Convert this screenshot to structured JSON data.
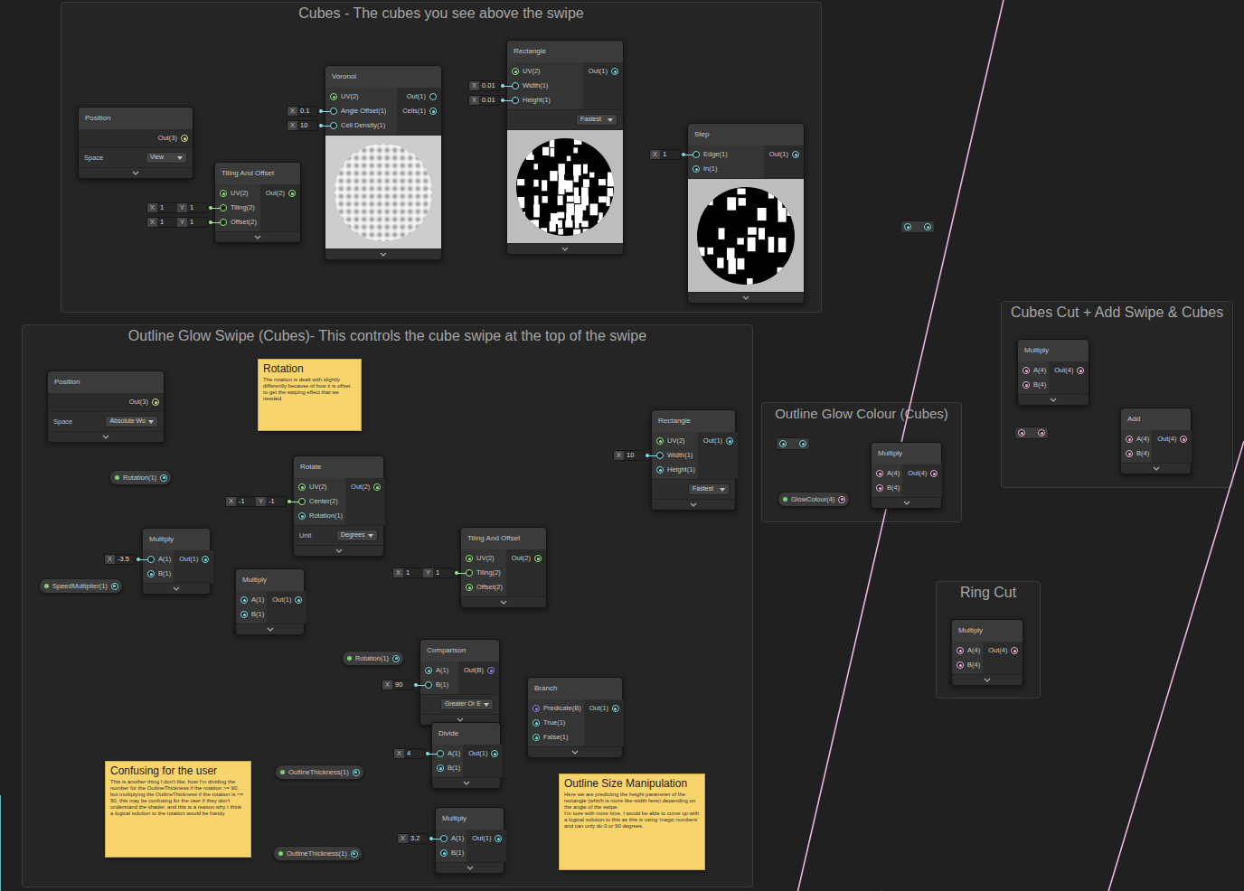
{
  "groups": [
    {
      "title": "Cubes - The cubes you see above the swipe"
    },
    {
      "title": "Outline Glow Swipe (Cubes)- This controls the cube swipe at the top of the swipe"
    },
    {
      "title": "Outline Glow Colour (Cubes)"
    },
    {
      "title": "Cubes Cut + Add Swipe & Cubes"
    },
    {
      "title": "Ring Cut"
    }
  ],
  "nodes": [
    {
      "title": "Position",
      "inputs": [],
      "outputs": [
        {
          "label": "Out(3)",
          "connected": true
        }
      ],
      "controls": [
        {
          "label": "Space",
          "value": "View"
        }
      ]
    },
    {
      "title": "Tiling And Offset",
      "inputs": [
        {
          "label": "UV(2)",
          "connected": true
        },
        {
          "label": "Tiling(2)",
          "connected": false,
          "field": [
            {
              "axis": "X",
              "value": "1"
            },
            {
              "axis": "Y",
              "value": "1"
            }
          ]
        },
        {
          "label": "Offset(2)",
          "connected": false,
          "field": [
            {
              "axis": "X",
              "value": "1"
            },
            {
              "axis": "Y",
              "value": "1"
            }
          ]
        }
      ],
      "outputs": [
        {
          "label": "Out(2)",
          "connected": true
        }
      ],
      "controls": []
    },
    {
      "title": "Voronoi",
      "inputs": [
        {
          "label": "UV(2)",
          "connected": true
        },
        {
          "label": "Angle Offset(1)",
          "connected": false,
          "field": [
            {
              "axis": "X",
              "value": "0.1"
            }
          ]
        },
        {
          "label": "Cell Density(1)",
          "connected": false,
          "field": [
            {
              "axis": "X",
              "value": "10"
            }
          ]
        }
      ],
      "outputs": [
        {
          "label": "Out(1)",
          "connected": false
        },
        {
          "label": "Cells(1)",
          "connected": true
        }
      ],
      "controls": [],
      "preview": {
        "kind": "voronoi"
      }
    },
    {
      "title": "Rectangle",
      "inputs": [
        {
          "label": "UV(2)",
          "connected": true
        },
        {
          "label": "Width(1)",
          "connected": false,
          "field": [
            {
              "axis": "X",
              "value": "0.01"
            }
          ]
        },
        {
          "label": "Height(1)",
          "connected": false,
          "field": [
            {
              "axis": "X",
              "value": "0.01"
            }
          ]
        }
      ],
      "outputs": [
        {
          "label": "Out(1)",
          "connected": true
        }
      ],
      "controls": [
        {
          "value": "Fastest"
        }
      ],
      "preview": {
        "kind": "rectangle"
      }
    },
    {
      "title": "Step",
      "inputs": [
        {
          "label": "Edge(1)",
          "connected": false,
          "field": [
            {
              "axis": "X",
              "value": "1"
            }
          ]
        },
        {
          "label": "In(1)",
          "connected": true
        }
      ],
      "outputs": [
        {
          "label": "Out(1)",
          "connected": true
        }
      ],
      "controls": [],
      "preview": {
        "kind": "step"
      }
    },
    {
      "title": "Position",
      "inputs": [],
      "outputs": [
        {
          "label": "Out(3)",
          "connected": true
        }
      ],
      "controls": [
        {
          "label": "Space",
          "value": "Absolute Wo"
        }
      ]
    },
    {
      "title": "Rotate",
      "inputs": [
        {
          "label": "UV(2)",
          "connected": true
        },
        {
          "label": "Center(2)",
          "connected": false,
          "field": [
            {
              "axis": "X",
              "value": "-1"
            },
            {
              "axis": "Y",
              "value": "-1"
            }
          ]
        },
        {
          "label": "Rotation(1)",
          "connected": true
        }
      ],
      "outputs": [
        {
          "label": "Out(2)",
          "connected": true
        }
      ],
      "controls": [
        {
          "label": "Unit",
          "value": "Degrees"
        }
      ]
    },
    {
      "title": "Multiply",
      "inputs": [
        {
          "label": "A(1)",
          "connected": false,
          "field": [
            {
              "axis": "X",
              "value": "-3.5"
            }
          ]
        },
        {
          "label": "B(1)",
          "connected": true
        }
      ],
      "outputs": [
        {
          "label": "Out(1)",
          "connected": true
        }
      ],
      "controls": []
    },
    {
      "title": "Multiply",
      "inputs": [
        {
          "label": "A(1)",
          "connected": true
        },
        {
          "label": "B(1)",
          "connected": true
        }
      ],
      "outputs": [
        {
          "label": "Out(1)",
          "connected": true
        }
      ],
      "controls": []
    },
    {
      "title": "Tiling And Offset",
      "inputs": [
        {
          "label": "UV(2)",
          "connected": true
        },
        {
          "label": "Tiling(2)",
          "connected": false,
          "field": [
            {
              "axis": "X",
              "value": "1"
            },
            {
              "axis": "Y",
              "value": "1"
            }
          ]
        },
        {
          "label": "Offset(2)",
          "connected": true
        }
      ],
      "outputs": [
        {
          "label": "Out(2)",
          "connected": true
        }
      ],
      "controls": []
    },
    {
      "title": "Rectangle",
      "inputs": [
        {
          "label": "UV(2)",
          "connected": true
        },
        {
          "label": "Width(1)",
          "connected": false,
          "field": [
            {
              "axis": "X",
              "value": "10"
            }
          ]
        },
        {
          "label": "Height(1)",
          "connected": true
        }
      ],
      "outputs": [
        {
          "label": "Out(1)",
          "connected": true
        }
      ],
      "controls": [
        {
          "value": "Fastest"
        }
      ]
    },
    {
      "title": "Comparison",
      "inputs": [
        {
          "label": "A(1)",
          "connected": true
        },
        {
          "label": "B(1)",
          "connected": false,
          "field": [
            {
              "axis": "X",
              "value": "90"
            }
          ]
        }
      ],
      "outputs": [
        {
          "label": "Out(B)",
          "connected": true
        }
      ],
      "controls": [
        {
          "value": "Greater Or E"
        }
      ]
    },
    {
      "title": "Branch",
      "inputs": [
        {
          "label": "Predicate(B)",
          "connected": true
        },
        {
          "label": "True(1)",
          "connected": true
        },
        {
          "label": "False(1)",
          "connected": true
        }
      ],
      "outputs": [
        {
          "label": "Out(1)",
          "connected": true
        }
      ],
      "controls": []
    },
    {
      "title": "Divide",
      "inputs": [
        {
          "label": "A(1)",
          "connected": false,
          "field": [
            {
              "axis": "X",
              "value": "4"
            }
          ]
        },
        {
          "label": "B(1)",
          "connected": true
        }
      ],
      "outputs": [
        {
          "label": "Out(1)",
          "connected": true
        }
      ],
      "controls": []
    },
    {
      "title": "Multiply",
      "inputs": [
        {
          "label": "A(1)",
          "connected": false,
          "field": [
            {
              "axis": "X",
              "value": "3.2"
            }
          ]
        },
        {
          "label": "B(1)",
          "connected": true
        }
      ],
      "outputs": [
        {
          "label": "Out(1)",
          "connected": true
        }
      ],
      "controls": []
    },
    {
      "title": "Multiply",
      "inputs": [
        {
          "label": "A(4)",
          "connected": true
        },
        {
          "label": "B(4)",
          "connected": true
        }
      ],
      "outputs": [
        {
          "label": "Out(4)",
          "connected": true
        }
      ],
      "controls": []
    },
    {
      "title": "Multiply",
      "inputs": [
        {
          "label": "A(4)",
          "connected": true
        },
        {
          "label": "B(4)",
          "connected": true
        }
      ],
      "outputs": [
        {
          "label": "Out(4)",
          "connected": true
        }
      ],
      "controls": []
    },
    {
      "title": "Add",
      "inputs": [
        {
          "label": "A(4)",
          "connected": true
        },
        {
          "label": "B(4)",
          "connected": true
        }
      ],
      "outputs": [
        {
          "label": "Out(4)",
          "connected": true
        }
      ],
      "controls": []
    },
    {
      "title": "Multiply",
      "inputs": [
        {
          "label": "A(4)",
          "connected": true
        },
        {
          "label": "B(4)",
          "connected": true
        }
      ],
      "outputs": [
        {
          "label": "Out(4)",
          "connected": true
        }
      ],
      "controls": []
    }
  ],
  "properties": [
    {
      "label": "Rotation(1)"
    },
    {
      "label": "SpeedMultiplier(1)"
    },
    {
      "label": "Rotation(1)"
    },
    {
      "label": "OutlineThickness(1)"
    },
    {
      "label": "OutlineThickness(1)"
    },
    {
      "label": "GlowColour(4)"
    }
  ],
  "notes": [
    {
      "title": "Rotation",
      "body": "The rotation is dealt with slightly differently because of how it is offset to get the swiping effect that we needed."
    },
    {
      "title": "Confusing for the user",
      "body": "This is another thing I don't like, how I'm dividing the number for the OutlineThickness if the rotation >= 90, but multiplying the OutlineThickness if the rotation is <= 90, this may be confusing for the user if they don't understand the shader, and this is a reason why I think a logical solution to the rotation would be handy"
    },
    {
      "title": "Outline Size Manipulation",
      "body": "Here we are predicting the height parameter of the rectangle (which is more like width here) depending on the angle of the swipe.\nI'm sure with more time, I would be able to come up with a logical solution to this as this is using 'magic numbers' and can only do 0 or 90 degrees."
    }
  ]
}
